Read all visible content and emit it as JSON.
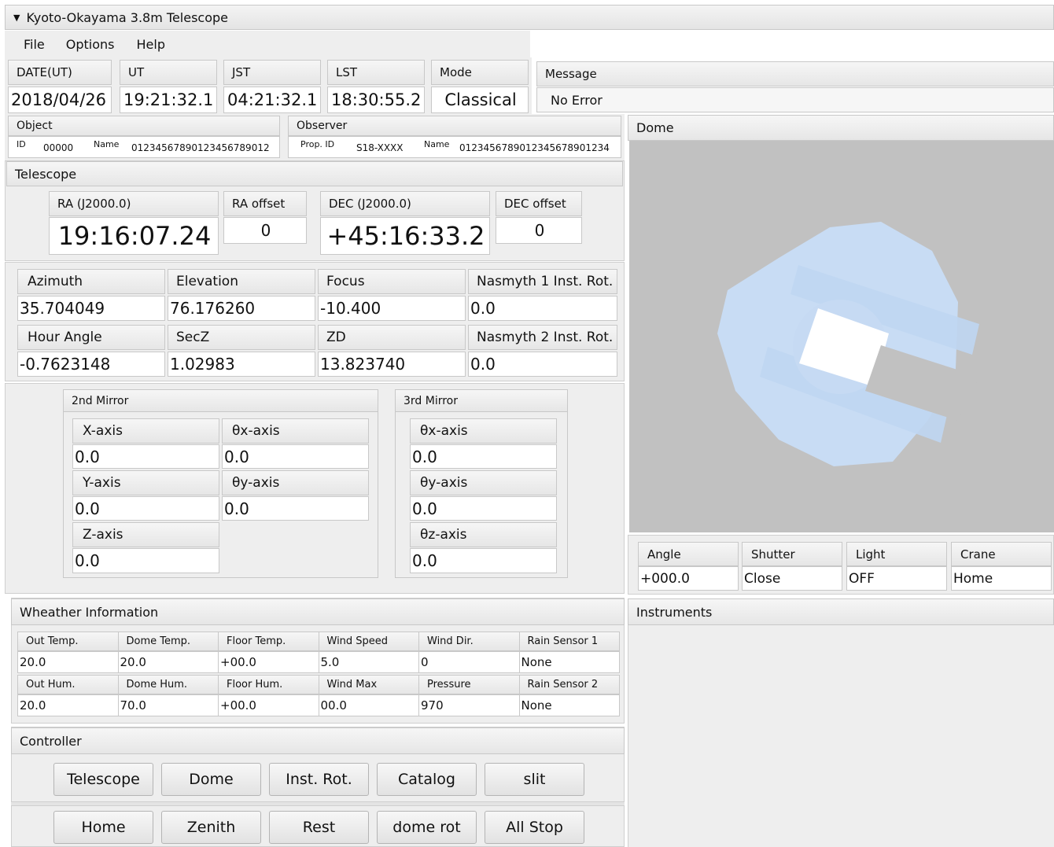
{
  "window": {
    "title": "Kyoto-Okayama 3.8m Telescope"
  },
  "menu": [
    "File",
    "Options",
    "Help"
  ],
  "status": [
    {
      "label": "DATE(UT)",
      "value": "2018/04/26"
    },
    {
      "label": "UT",
      "value": "19:21:32.1"
    },
    {
      "label": "JST",
      "value": "04:21:32.1"
    },
    {
      "label": "LST",
      "value": "18:30:55.2"
    },
    {
      "label": "Mode",
      "value": "Classical"
    }
  ],
  "message": {
    "label": "Message",
    "value": "No Error"
  },
  "object": {
    "title": "Object",
    "id_label": "ID",
    "id": "00000",
    "name_label": "Name",
    "name": "0123456789012345678​9012"
  },
  "observer": {
    "title": "Observer",
    "prop_label": "Prop. ID",
    "prop": "S18-XXXX",
    "name_label": "Name",
    "name": "0123456789012345678901234"
  },
  "telescope": {
    "title": "Telescope",
    "ra_label": "RA (J2000.0)",
    "ra": "19:16:07.24",
    "ra_offset_label": "RA offset",
    "ra_offset": "0",
    "dec_label": "DEC (J2000.0)",
    "dec": "+45:16:33.2",
    "dec_offset_label": "DEC offset",
    "dec_offset": "0"
  },
  "position": [
    [
      {
        "label": "Azimuth",
        "value": "35.704049"
      },
      {
        "label": "Elevation",
        "value": "76.176260"
      },
      {
        "label": "Focus",
        "value": "-10.400"
      },
      {
        "label": "Nasmyth 1 Inst. Rot.",
        "value": "0.0"
      }
    ],
    [
      {
        "label": "Hour Angle",
        "value": "-0.7623148"
      },
      {
        "label": "SecZ",
        "value": "1.02983"
      },
      {
        "label": "ZD",
        "value": "13.823740"
      },
      {
        "label": "Nasmyth 2 Inst. Rot.",
        "value": "0.0"
      }
    ]
  ],
  "mirror2": {
    "title": "2nd Mirror",
    "x_label": "X-axis",
    "x": "0.0",
    "tx_label": "θx-axis",
    "tx": "0.0",
    "y_label": "Y-axis",
    "y": "0.0",
    "ty_label": "θy-axis",
    "ty": "0.0",
    "z_label": "Z-axis",
    "z": "0.0"
  },
  "mirror3": {
    "title": "3rd Mirror",
    "tx_label": "θx-axis",
    "tx": "0.0",
    "ty_label": "θy-axis",
    "ty": "0.0",
    "tz_label": "θz-axis",
    "tz": "0.0"
  },
  "dome": {
    "title": "Dome",
    "status": [
      {
        "label": "Angle",
        "value": "+000.0"
      },
      {
        "label": "Shutter",
        "value": "Close"
      },
      {
        "label": "Light",
        "value": "OFF"
      },
      {
        "label": "Crane",
        "value": "Home"
      }
    ],
    "colors": {
      "background": "#c1c1c1",
      "dome": "#c8dcf4",
      "opening": "#ffffff"
    }
  },
  "weather": {
    "title": "Wheather Information",
    "rows": [
      [
        {
          "label": "Out Temp.",
          "value": "20.0"
        },
        {
          "label": "Dome Temp.",
          "value": "20.0"
        },
        {
          "label": "Floor Temp.",
          "value": "+00.0"
        },
        {
          "label": "Wind Speed",
          "value": "5.0"
        },
        {
          "label": "Wind Dir.",
          "value": "0"
        },
        {
          "label": "Rain Sensor 1",
          "value": "None"
        }
      ],
      [
        {
          "label": "Out Hum.",
          "value": "20.0"
        },
        {
          "label": "Dome Hum.",
          "value": "70.0"
        },
        {
          "label": "Floor Hum.",
          "value": "+00.0"
        },
        {
          "label": "Wind Max",
          "value": "00.0"
        },
        {
          "label": "Pressure",
          "value": "970"
        },
        {
          "label": "Rain Sensor 2",
          "value": "None"
        }
      ]
    ]
  },
  "controller": {
    "title": "Controller",
    "row1": [
      "Telescope",
      "Dome",
      "Inst. Rot.",
      "Catalog",
      "slit"
    ],
    "row2": [
      "Home",
      "Zenith",
      "Rest",
      "dome rot",
      "All Stop"
    ]
  },
  "instruments": {
    "title": "Instruments"
  }
}
